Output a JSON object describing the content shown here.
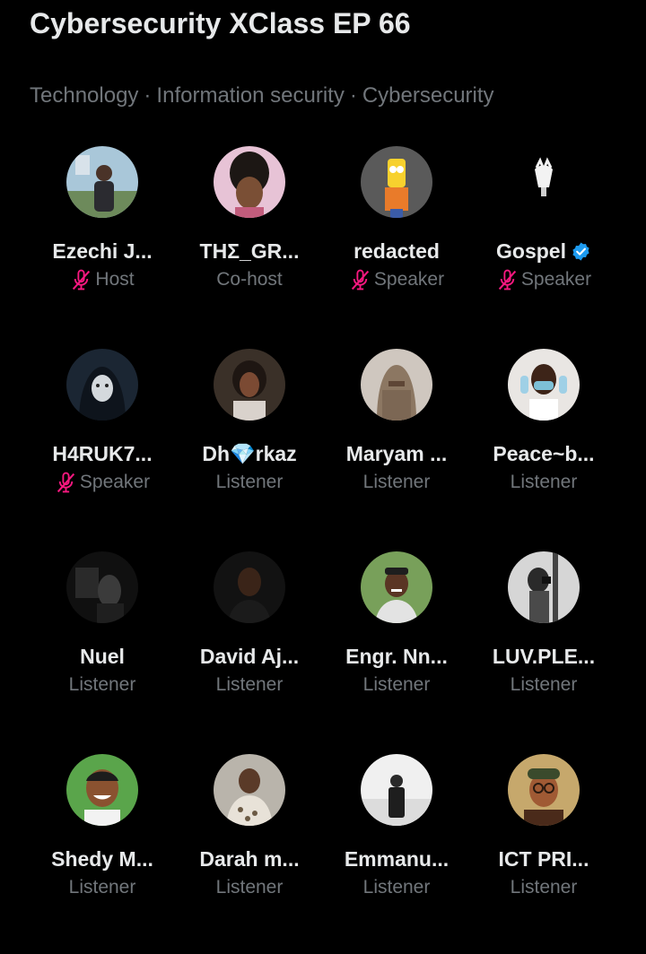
{
  "space": {
    "title": "Cybersecurity XClass EP 66",
    "topics": [
      "Technology",
      "Information security",
      "Cybersecurity"
    ],
    "topic_separator": "·"
  },
  "colors": {
    "background": "#000000",
    "primary_text": "#e7e9ea",
    "secondary_text": "#71767b",
    "muted_mic": "#f91880",
    "verified": "#1d9bf0"
  },
  "participants": [
    {
      "name": "Ezechi J...",
      "role": "Host",
      "muted": true,
      "verified": false,
      "avatar": "photo-man-outdoors"
    },
    {
      "name": "ΤΗΣ_GR...",
      "role": "Co-host",
      "muted": false,
      "verified": false,
      "avatar": "photo-woman-braids"
    },
    {
      "name": "redacted",
      "role": "Speaker",
      "muted": true,
      "verified": false,
      "avatar": "cartoon-character"
    },
    {
      "name": "Gospel",
      "role": "Speaker",
      "muted": true,
      "verified": true,
      "avatar": "figure-hands-on-face"
    },
    {
      "name": "H4RUK7...",
      "role": "Speaker",
      "muted": true,
      "verified": false,
      "avatar": "hooded-mask"
    },
    {
      "name": "Dh💎rkaz",
      "role": "Listener",
      "muted": false,
      "verified": false,
      "avatar": "photo-woman-selfie"
    },
    {
      "name": "Maryam ...",
      "role": "Listener",
      "muted": false,
      "verified": false,
      "avatar": "photo-niqab"
    },
    {
      "name": "Peace~b...",
      "role": "Listener",
      "muted": false,
      "verified": false,
      "avatar": "photo-mask-gloves"
    },
    {
      "name": "Nuel",
      "role": "Listener",
      "muted": false,
      "verified": false,
      "avatar": "photo-dark-room"
    },
    {
      "name": "David Aj...",
      "role": "Listener",
      "muted": false,
      "verified": false,
      "avatar": "photo-man-portrait"
    },
    {
      "name": "Engr. Nn...",
      "role": "Listener",
      "muted": false,
      "verified": false,
      "avatar": "photo-man-smiling-cap"
    },
    {
      "name": "LUV.PLE...",
      "role": "Listener",
      "muted": false,
      "verified": false,
      "avatar": "photo-bw-mirror-selfie"
    },
    {
      "name": "Shedy M...",
      "role": "Listener",
      "muted": false,
      "verified": false,
      "avatar": "cartoon-man-smiling"
    },
    {
      "name": "Darah m...",
      "role": "Listener",
      "muted": false,
      "verified": false,
      "avatar": "photo-man-patterned-shirt"
    },
    {
      "name": "Emmanu...",
      "role": "Listener",
      "muted": false,
      "verified": false,
      "avatar": "photo-suit-back-view"
    },
    {
      "name": "ICT PRI...",
      "role": "Listener",
      "muted": false,
      "verified": false,
      "avatar": "painting-man-cap"
    }
  ]
}
